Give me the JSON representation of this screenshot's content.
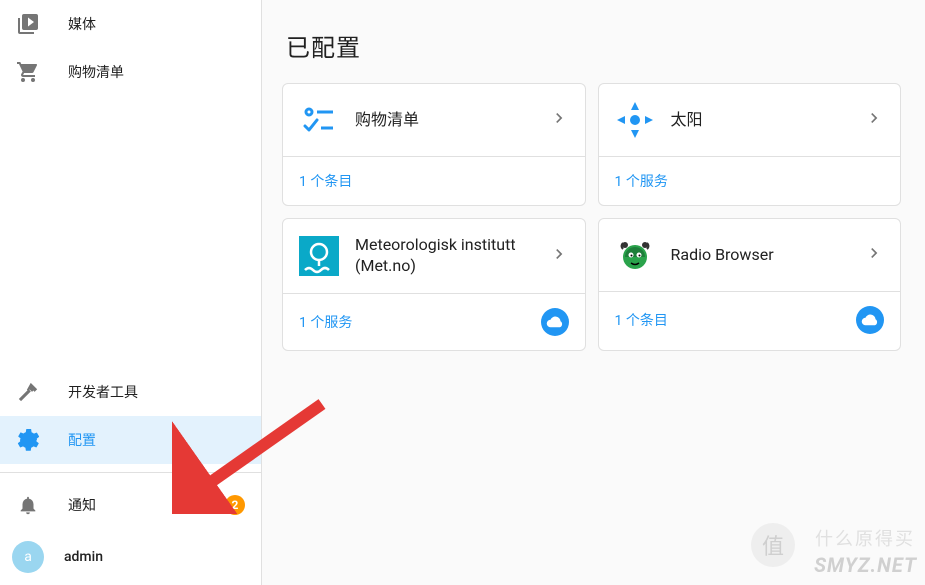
{
  "sidebar": {
    "top_items": [
      {
        "id": "media",
        "label": "媒体",
        "icon": "play-box",
        "active": false
      },
      {
        "id": "shopping",
        "label": "购物清单",
        "icon": "cart",
        "active": false
      }
    ],
    "bottom_items": [
      {
        "id": "devtools",
        "label": "开发者工具",
        "icon": "hammer",
        "active": false
      },
      {
        "id": "config",
        "label": "配置",
        "icon": "gear",
        "active": true
      }
    ],
    "notifications": {
      "label": "通知",
      "count": 2
    },
    "user": {
      "initial": "a",
      "name": "admin"
    }
  },
  "main": {
    "title": "已配置",
    "cards": [
      {
        "id": "shopping-list",
        "title": "购物清单",
        "meta": "1 个条目",
        "icon": "shopping-list",
        "cloud": false
      },
      {
        "id": "sun",
        "title": "太阳",
        "meta": "1 个服务",
        "icon": "sun",
        "cloud": false
      },
      {
        "id": "metno",
        "title": "Meteorologisk institutt (Met.no)",
        "meta": "1 个服务",
        "icon": "metno",
        "cloud": true
      },
      {
        "id": "radio",
        "title": "Radio Browser",
        "meta": "1 个条目",
        "icon": "radio",
        "cloud": true
      }
    ]
  },
  "watermark": {
    "text": "SMYZ.NET",
    "zh": "什么原得买",
    "circle": "值"
  },
  "colors": {
    "accent": "#2196F3",
    "badge": "#ff9800"
  }
}
